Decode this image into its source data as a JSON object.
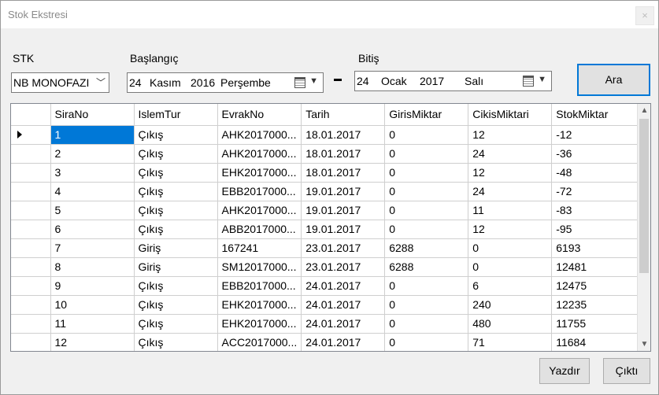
{
  "window": {
    "title": "Stok Ekstresi",
    "close_glyph": "×"
  },
  "filters": {
    "stk_label": "STK",
    "stk_value": "NB MONOFAZI",
    "start_label": "Başlangıç",
    "start_day": "24",
    "start_month": "Kasım",
    "start_year": "2016",
    "start_weekday": "Perşembe",
    "end_label": "Bitiş",
    "end_day": "24",
    "end_month": "Ocak",
    "end_year": "2017",
    "end_weekday": "Salı",
    "search_button": "Ara"
  },
  "grid": {
    "columns": [
      "SiraNo",
      "IslemTur",
      "EvrakNo",
      "Tarih",
      "GirisMiktar",
      "CikisMiktari",
      "StokMiktar"
    ],
    "rows": [
      [
        "1",
        "Çıkış",
        "AHK2017000...",
        "18.01.2017",
        "0",
        "12",
        "-12"
      ],
      [
        "2",
        "Çıkış",
        "AHK2017000...",
        "18.01.2017",
        "0",
        "24",
        "-36"
      ],
      [
        "3",
        "Çıkış",
        "EHK2017000...",
        "18.01.2017",
        "0",
        "12",
        "-48"
      ],
      [
        "4",
        "Çıkış",
        "EBB2017000...",
        "19.01.2017",
        "0",
        "24",
        "-72"
      ],
      [
        "5",
        "Çıkış",
        "AHK2017000...",
        "19.01.2017",
        "0",
        "11",
        "-83"
      ],
      [
        "6",
        "Çıkış",
        "ABB2017000...",
        "19.01.2017",
        "0",
        "12",
        "-95"
      ],
      [
        "7",
        "Giriş",
        "167241",
        "23.01.2017",
        "6288",
        "0",
        "6193"
      ],
      [
        "8",
        "Giriş",
        "SM12017000...",
        "23.01.2017",
        "6288",
        "0",
        "12481"
      ],
      [
        "9",
        "Çıkış",
        "EBB2017000...",
        "24.01.2017",
        "0",
        "6",
        "12475"
      ],
      [
        "10",
        "Çıkış",
        "EHK2017000...",
        "24.01.2017",
        "0",
        "240",
        "12235"
      ],
      [
        "11",
        "Çıkış",
        "EHK2017000...",
        "24.01.2017",
        "0",
        "480",
        "11755"
      ],
      [
        "12",
        "Çıkış",
        "ACC2017000...",
        "24.01.2017",
        "0",
        "71",
        "11684"
      ]
    ]
  },
  "footer": {
    "print_button": "Yazdır",
    "exit_button": "Çıktı"
  },
  "colors": {
    "selection": "#0078d7",
    "window_bg": "#f0f0f0"
  }
}
